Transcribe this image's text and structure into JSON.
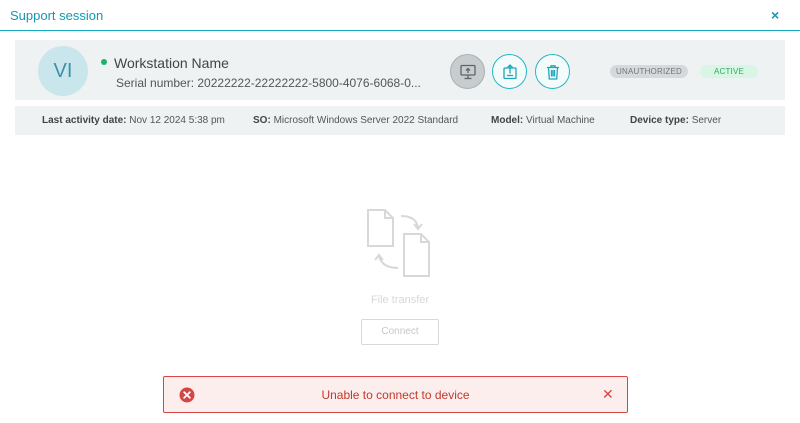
{
  "window": {
    "title": "Support session",
    "close_glyph": "×"
  },
  "device": {
    "avatar_initials": "VI",
    "name": "Workstation Name",
    "serial_text": "Serial number: 20222222-22222222-5800-4076-6068-0...",
    "online_status_color": "#1bb36b",
    "actions": [
      {
        "icon": "remote-desktop-icon"
      },
      {
        "icon": "upload-icon"
      },
      {
        "icon": "trash-icon"
      }
    ],
    "badges": {
      "authorization": "UNAUTHORIZED",
      "state": "ACTIVE"
    }
  },
  "details": {
    "last_activity_label": "Last activity date:",
    "last_activity_value": "Nov 12 2024 5:38 pm",
    "os_label": "SO:",
    "os_value": "Microsoft Windows Server 2022 Standard",
    "model_label": "Model:",
    "model_value": "Virtual Machine",
    "device_type_label": "Device type:",
    "device_type_value": "Server"
  },
  "file_transfer": {
    "icon": "file-transfer-icon",
    "label": "File transfer",
    "connect_label": "Connect"
  },
  "toast": {
    "icon": "error-circle-icon",
    "message": "Unable to connect to device",
    "close_glyph": "✕",
    "color": "#d44646"
  },
  "colors": {
    "accent": "#14a8bf",
    "error": "#d44646",
    "success": "#27ae60"
  }
}
